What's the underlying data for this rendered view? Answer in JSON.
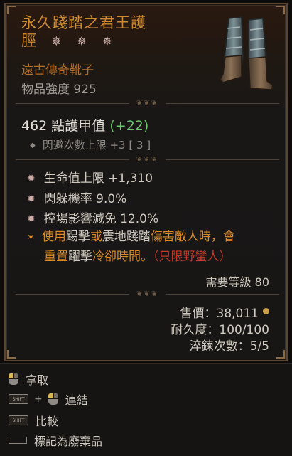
{
  "item": {
    "name_line1": "永久踐踏之君王護",
    "name_line2": "脛",
    "stars": [
      "✵",
      "✵",
      "✵"
    ],
    "type": "遠古傳奇靴子",
    "power": "物品強度 925",
    "image_icon": "boots-icon"
  },
  "armor": {
    "value": "462 點護甲值",
    "bonus": "(+22)"
  },
  "implicit": "閃避次數上限 +3 [ 3 ]",
  "affixes": [
    "生命值上限 +1,310",
    "閃躲機率 9.0%",
    "控場影響減免 12.0%"
  ],
  "legendary": {
    "seg1": "使用",
    "seg2": "踢擊",
    "seg3": "或",
    "seg4": "震地踐踏",
    "seg5": "傷害敵人時，會",
    "seg6": "重置",
    "seg7": "躍擊",
    "seg8": "冷卻時間。",
    "seg9": "（只限野蠻人）"
  },
  "requirements": "需要等級 80",
  "footer": {
    "price": "售價：38,011",
    "durability": "耐久度：100/100",
    "temper": "淬鍊次數：5/5"
  },
  "hints": [
    {
      "key": "mouse-left-icon",
      "label": "拿取"
    },
    {
      "key": "SHIFT",
      "label": "連結"
    },
    {
      "key": "SHIFT",
      "label": "比較"
    },
    {
      "key": "spacebar-icon",
      "label": "標記為廢棄品"
    }
  ],
  "colors": {
    "legendary_orange": "#ce8a2e",
    "stat_green": "#6cc36a",
    "class_red": "#c0392b"
  }
}
